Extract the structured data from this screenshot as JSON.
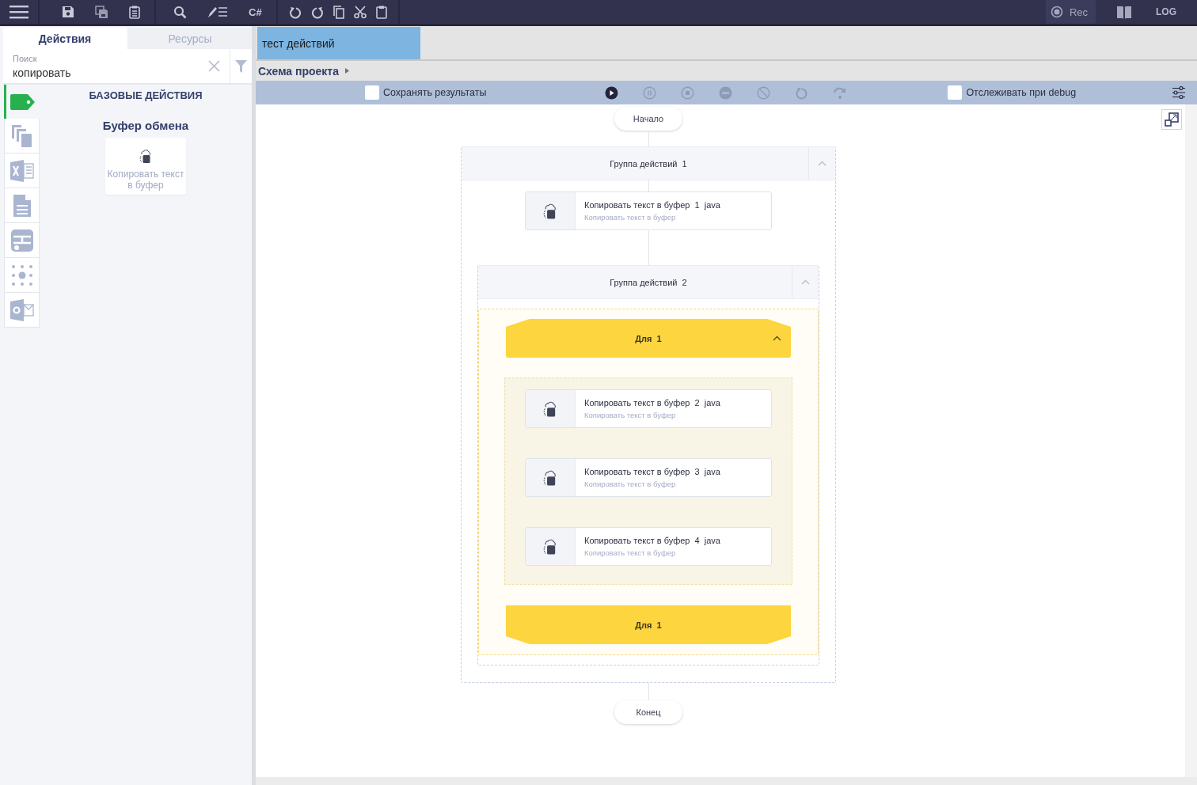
{
  "toolbar": {
    "csharp_label": "C#",
    "rec_label": "Rec",
    "log_label": "LOG"
  },
  "left_panel": {
    "tabs": [
      {
        "label": "Действия",
        "selected": true
      },
      {
        "label": "Ресурсы",
        "selected": false
      }
    ],
    "search": {
      "label": "Поиск",
      "value": "копировать"
    },
    "rail": [
      {
        "selected": true
      },
      {
        "selected": false
      },
      {
        "selected": false
      },
      {
        "selected": false
      },
      {
        "selected": false
      },
      {
        "selected": false
      },
      {
        "selected": false
      }
    ],
    "heading": "БАЗОВЫЕ ДЕЙСТВИЯ",
    "category": "Буфер обмена",
    "actions": [
      "Копировать текст в буфер"
    ]
  },
  "document_tabs": [
    {
      "label": "тест действий",
      "selected": true
    }
  ],
  "breadcrumb": "Схема проекта",
  "debug_bar": {
    "save_results": {
      "label": "Сохранять результаты",
      "checked": false
    },
    "run_controls": [
      {
        "disabled": false
      },
      {
        "disabled": true
      },
      {
        "disabled": true
      },
      {
        "disabled": true
      },
      {
        "disabled": true
      },
      {
        "disabled": true
      },
      {
        "disabled": true
      }
    ],
    "track_debug": {
      "label": "Отслеживать при debug",
      "checked": false
    }
  },
  "flow": {
    "start": "Начало",
    "end": "Конец",
    "items": [
      {
        "kind": "group",
        "title": "Группа действий  1",
        "items": [
          {
            "kind": "action",
            "title": "Копировать текст в буфер  1  java",
            "subtitle": "Копировать текст в буфер"
          },
          {
            "kind": "group",
            "title": "Группа действий  2",
            "items": [
              {
                "kind": "loop",
                "title": "Для  1",
                "footer": "Для  1",
                "items": [
                  {
                    "kind": "action",
                    "title": "Копировать текст в буфер  2  java",
                    "subtitle": "Копировать текст в буфер"
                  },
                  {
                    "kind": "action",
                    "title": "Копировать текст в буфер  3  java",
                    "subtitle": "Копировать текст в буфер"
                  },
                  {
                    "kind": "action",
                    "title": "Копировать текст в буфер  4  java",
                    "subtitle": "Копировать текст в буфер"
                  }
                ]
              }
            ]
          }
        ]
      }
    ]
  }
}
